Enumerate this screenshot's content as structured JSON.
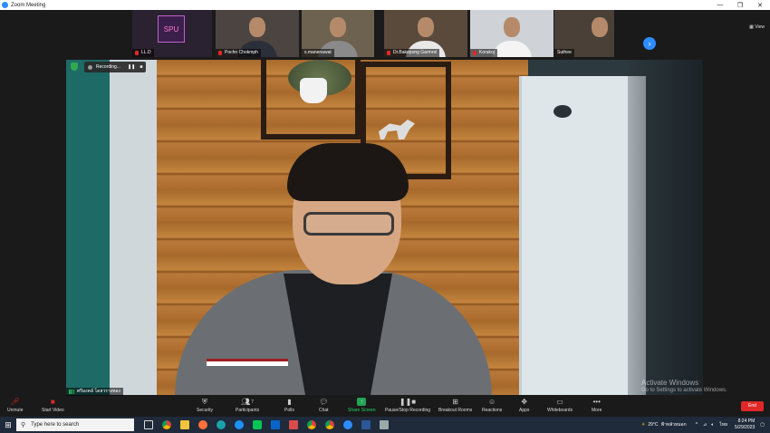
{
  "window": {
    "title": "Zoom Meeting",
    "controls": [
      "—",
      "❐",
      "✕"
    ]
  },
  "gallery": {
    "view_label": "View",
    "participants": [
      {
        "name": "LL.D",
        "muted": true
      },
      {
        "name": "Pochn Chokmph",
        "muted": true
      },
      {
        "name": "s.manenawat",
        "muted": false
      },
      {
        "name": "Dr.Bakepong Garmrol",
        "muted": true
      },
      {
        "name": "Korakoj",
        "muted": true
      },
      {
        "name": "Suthee",
        "muted": false
      }
    ],
    "next_icon": "›"
  },
  "main_video": {
    "recording_label": "Recording...",
    "speaker_name": "ศรีมงคล์ โดสวรางทอง"
  },
  "watermark": {
    "line1": "Activate Windows",
    "line2": "Go to Settings to activate Windows."
  },
  "toolbar": {
    "unmute": "Unmute",
    "start_video": "Start Video",
    "security": "Security",
    "participants": "Participants",
    "participants_count": "7",
    "polls": "Polls",
    "chat": "Chat",
    "share_screen": "Share Screen",
    "pause_recording": "Pause/Stop Recording",
    "breakout_rooms": "Breakout Rooms",
    "reactions": "Reactions",
    "apps": "Apps",
    "whiteboards": "Whiteboards",
    "more": "More",
    "end": "End"
  },
  "taskbar": {
    "search_placeholder": "Type here to search",
    "weather": "29°C",
    "weather_desc": "ฟ้าหลัวหมอก",
    "language": "ไทย",
    "time": "8:24 PM",
    "date": "5/29/2023"
  }
}
